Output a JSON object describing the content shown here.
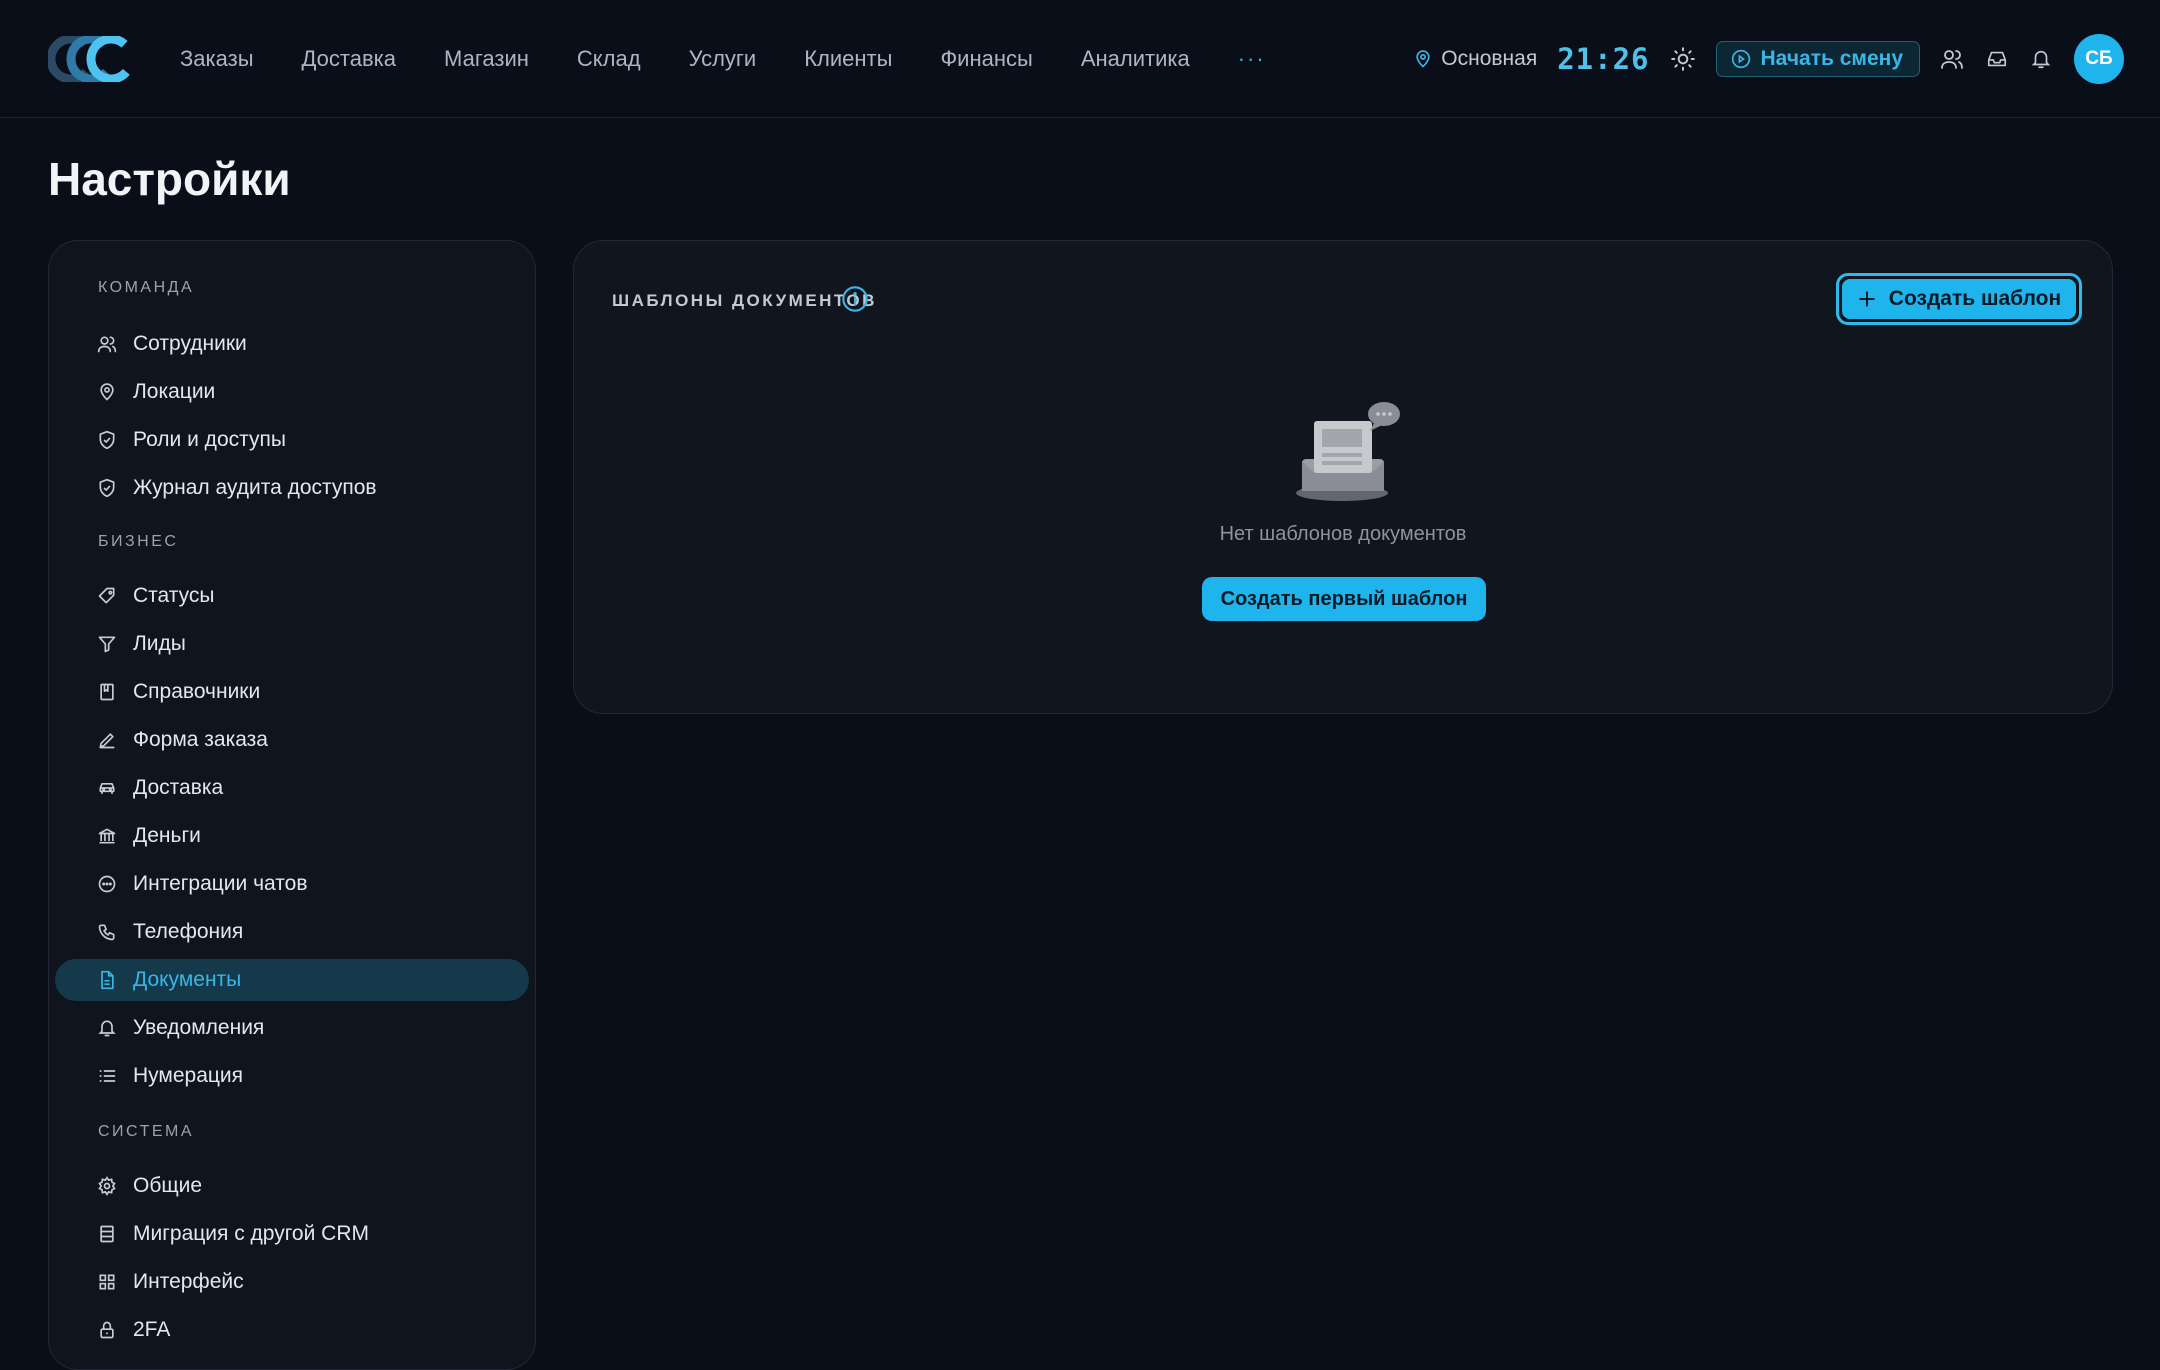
{
  "header": {
    "logo": "CCC",
    "nav": [
      "Заказы",
      "Доставка",
      "Магазин",
      "Склад",
      "Услуги",
      "Клиенты",
      "Финансы",
      "Аналитика"
    ],
    "more_label": "···",
    "location": "Основная",
    "clock": "21:26",
    "shift_button": "Начать смену",
    "avatar_initials": "СБ"
  },
  "page": {
    "title": "Настройки"
  },
  "sidebar": {
    "sections": [
      {
        "title": "КОМАНДА",
        "items": [
          {
            "label": "Сотрудники",
            "icon": "users-icon"
          },
          {
            "label": "Локации",
            "icon": "map-pin-icon"
          },
          {
            "label": "Роли и доступы",
            "icon": "shield-check-icon"
          },
          {
            "label": "Журнал аудита доступов",
            "icon": "shield-check-icon"
          }
        ]
      },
      {
        "title": "БИЗНЕС",
        "items": [
          {
            "label": "Статусы",
            "icon": "tag-icon"
          },
          {
            "label": "Лиды",
            "icon": "funnel-icon"
          },
          {
            "label": "Справочники",
            "icon": "book-icon"
          },
          {
            "label": "Форма заказа",
            "icon": "pen-icon"
          },
          {
            "label": "Доставка",
            "icon": "car-icon"
          },
          {
            "label": "Деньги",
            "icon": "bank-icon"
          },
          {
            "label": "Интеграции чатов",
            "icon": "chat-icon"
          },
          {
            "label": "Телефония",
            "icon": "phone-icon"
          },
          {
            "label": "Документы",
            "icon": "file-text-icon",
            "active": true
          },
          {
            "label": "Уведомления",
            "icon": "bell-icon"
          },
          {
            "label": "Нумерация",
            "icon": "list-icon"
          }
        ]
      },
      {
        "title": "СИСТЕМА",
        "items": [
          {
            "label": "Общие",
            "icon": "gear-icon"
          },
          {
            "label": "Миграция с другой CRM",
            "icon": "database-icon"
          },
          {
            "label": "Интерфейс",
            "icon": "grid-icon"
          },
          {
            "label": "2FA",
            "icon": "lock-icon"
          }
        ]
      }
    ]
  },
  "main": {
    "section_title": "ШАБЛОНЫ ДОКУМЕНТОВ",
    "create_button": "Создать шаблон",
    "empty_text": "Нет шаблонов документов",
    "first_button": "Создать первый шаблон"
  },
  "colors": {
    "background": "#0a0e19",
    "panel": "#11151d",
    "accent": "#1fb4ec",
    "active_item_bg": "#14394b",
    "active_item_text": "#3ab6e6"
  }
}
